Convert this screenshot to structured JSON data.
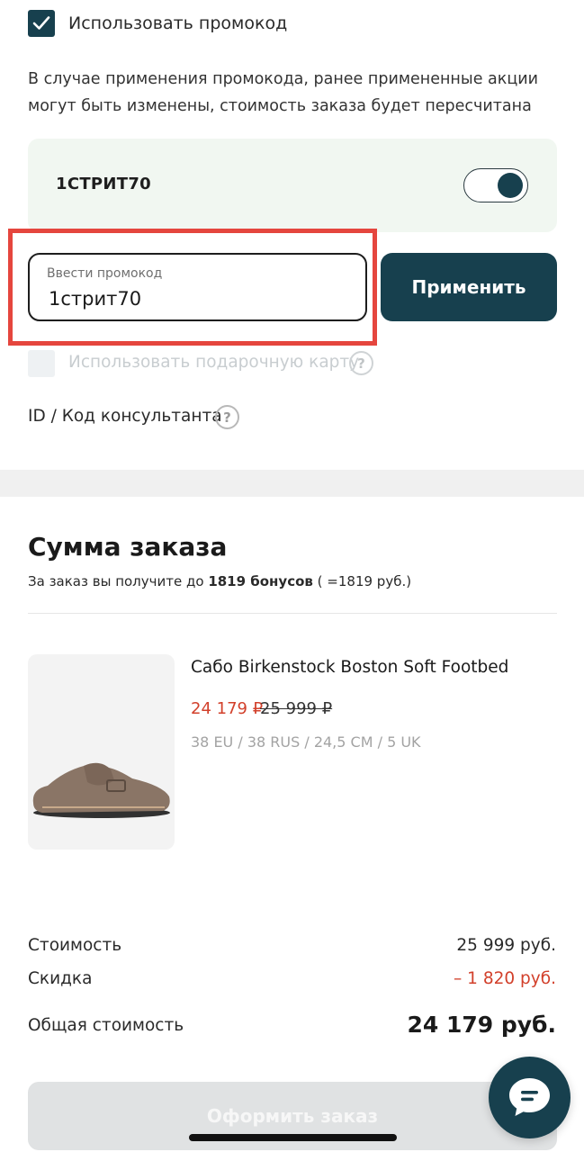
{
  "promo_section": {
    "use_promo_label": "Использовать промокод",
    "use_promo_checked": true,
    "note_line1": "В случае применения промокода, ранее примененные акции",
    "note_line2": "могут быть изменены, стоимость заказа будет пересчитана",
    "applied_code": "1СТРИТ70",
    "applied_code_toggle_on": true,
    "input_caption": "Ввести промокод",
    "input_value": "1стрит70",
    "apply_label": "Применить",
    "gift_card_label": "Использовать подарочную карту",
    "gift_card_checked": false,
    "consultant_label": "ID / Код консультанта",
    "help_glyph": "?"
  },
  "summary": {
    "title": "Сумма заказа",
    "bonus_prefix": "За заказ вы получите до ",
    "bonus_amount": "1819 бонусов",
    "bonus_suffix": " ( =1819 руб.)"
  },
  "product": {
    "image_icon": "clog-shoe-image",
    "name": "Сабо Birkenstock Boston Soft Footbed",
    "price_new": "24 179 ₽",
    "price_old": "25 999 ₽",
    "size": "38 EU / 38 RUS / 24,5 CM / 5 UK"
  },
  "totals": {
    "cost_label": "Стоимость",
    "cost_value": "25 999 руб.",
    "discount_label": "Скидка",
    "discount_value": "– 1 820 руб.",
    "total_label": "Общая стоимость",
    "total_value": "24 179 руб."
  },
  "checkout": {
    "button_label": "Оформить заказ"
  },
  "chat": {
    "icon": "chat-bubble-icon"
  },
  "colors": {
    "primary": "#17404e",
    "accent_red": "#d2402b",
    "highlight_frame": "#e5463e",
    "promo_card_bg": "#f1f7f1"
  }
}
